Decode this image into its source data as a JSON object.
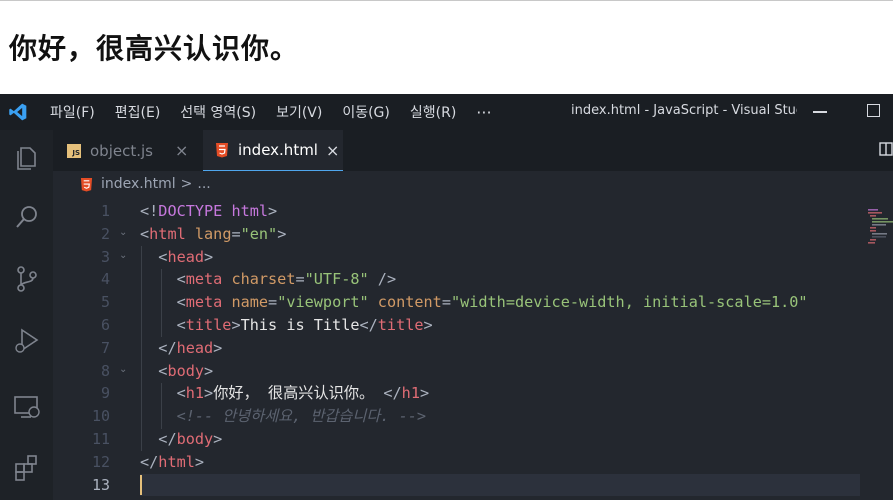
{
  "browser_page": {
    "heading": "你好，很高兴认识你。"
  },
  "titlebar": {
    "menu": [
      "파일(F)",
      "편집(E)",
      "선택 영역(S)",
      "보기(V)",
      "이동(G)",
      "실행(R)"
    ],
    "more": "···",
    "window_title": "index.html - JavaScript - Visual Studio Code"
  },
  "tabs": [
    {
      "label": "object.js",
      "badge": "JS",
      "active": false,
      "close": "×"
    },
    {
      "label": "index.html",
      "active": true,
      "close": "×"
    }
  ],
  "breadcrumb": {
    "file": "index.html",
    "sep": ">",
    "rest": "..."
  },
  "editor": {
    "current_line": 13,
    "lines": [
      {
        "n": "1"
      },
      {
        "n": "2"
      },
      {
        "n": "3"
      },
      {
        "n": "4"
      },
      {
        "n": "5"
      },
      {
        "n": "6"
      },
      {
        "n": "7"
      },
      {
        "n": "8"
      },
      {
        "n": "9"
      },
      {
        "n": "10"
      },
      {
        "n": "11"
      },
      {
        "n": "12"
      },
      {
        "n": "13"
      }
    ],
    "tokens": {
      "l1_open": "<!",
      "l1_doctype": "DOCTYPE",
      "l1_html": "html",
      "l1_close": ">",
      "l2_tag": "html",
      "l2_attr": "lang",
      "l2_val": "\"en\"",
      "l3_tag": "head",
      "l4_tag": "meta",
      "l4_attr": "charset",
      "l4_val": "\"UTF-8\"",
      "l4_end": " />",
      "l5_tag": "meta",
      "l5_attr1": "name",
      "l5_val1": "\"viewport\"",
      "l5_attr2": "content",
      "l5_val2": "\"width=device-width, initial-scale=1.0\"",
      "l6_tag": "title",
      "l6_text": "This is Title",
      "l7_tag": "head",
      "l8_tag": "body",
      "l9_tag": "h1",
      "l9_text": "你好， 很高兴认识你。",
      "l10_comment": "<!-- 안녕하세요, 반갑습니다. -->",
      "l11_tag": "body",
      "l12_tag": "html"
    }
  },
  "colors": {
    "background": "#23272e",
    "tag": "#e06c75",
    "attr": "#d19a66",
    "string": "#98c379",
    "keyword": "#c678dd",
    "comment": "#5c6370",
    "accent": "#4fa6ed"
  }
}
